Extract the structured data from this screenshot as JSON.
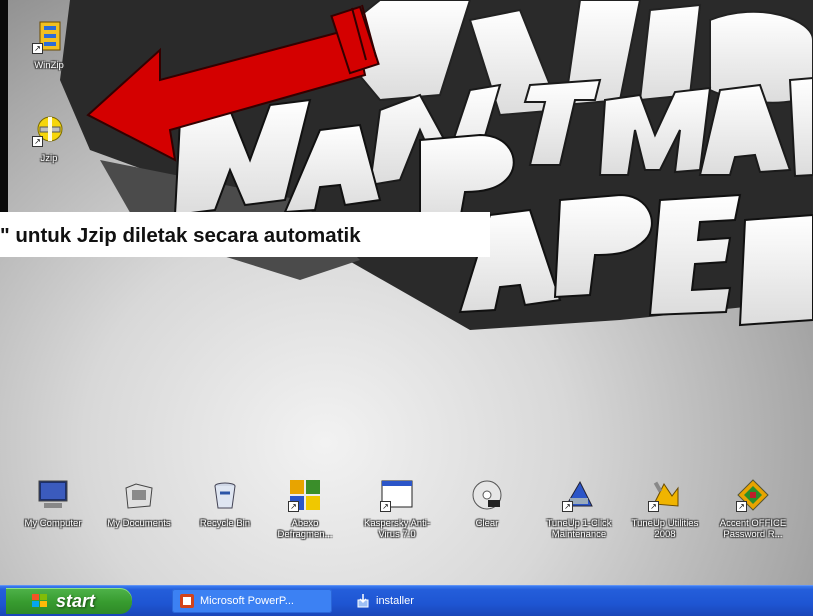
{
  "caption": "\" untuk Jzip diletak secara automatik",
  "desktop_icons_top": [
    {
      "name": "winzip-icon",
      "label": "WinZip"
    },
    {
      "name": "jzip-icon",
      "label": "Jzip"
    }
  ],
  "desktop_icons_bottom": [
    {
      "name": "my-computer-icon",
      "label": "My Computer"
    },
    {
      "name": "my-documents-icon",
      "label": "My Documents"
    },
    {
      "name": "recycle-bin-icon",
      "label": "Recycle Bin"
    },
    {
      "name": "abexo-icon",
      "label": "Abexo Defragmen..."
    },
    {
      "name": "kaspersky-icon",
      "label": "Kaspersky Anti-Virus 7.0"
    },
    {
      "name": "clear-icon",
      "label": "Clear"
    },
    {
      "name": "tuneup-1click-icon",
      "label": "TuneUp 1-Click Maintenance"
    },
    {
      "name": "tuneup-utilities-icon",
      "label": "TuneUp Utilities 2008"
    },
    {
      "name": "accent-office-icon",
      "label": "Accent OFFICE Password R..."
    }
  ],
  "taskbar": {
    "start_label": "start",
    "tasks": [
      {
        "label": "Microsoft PowerP..."
      },
      {
        "label": "installer"
      }
    ]
  },
  "colors": {
    "arrow": "#d40000",
    "taskbar": "#245edb",
    "start": "#379b2f"
  }
}
